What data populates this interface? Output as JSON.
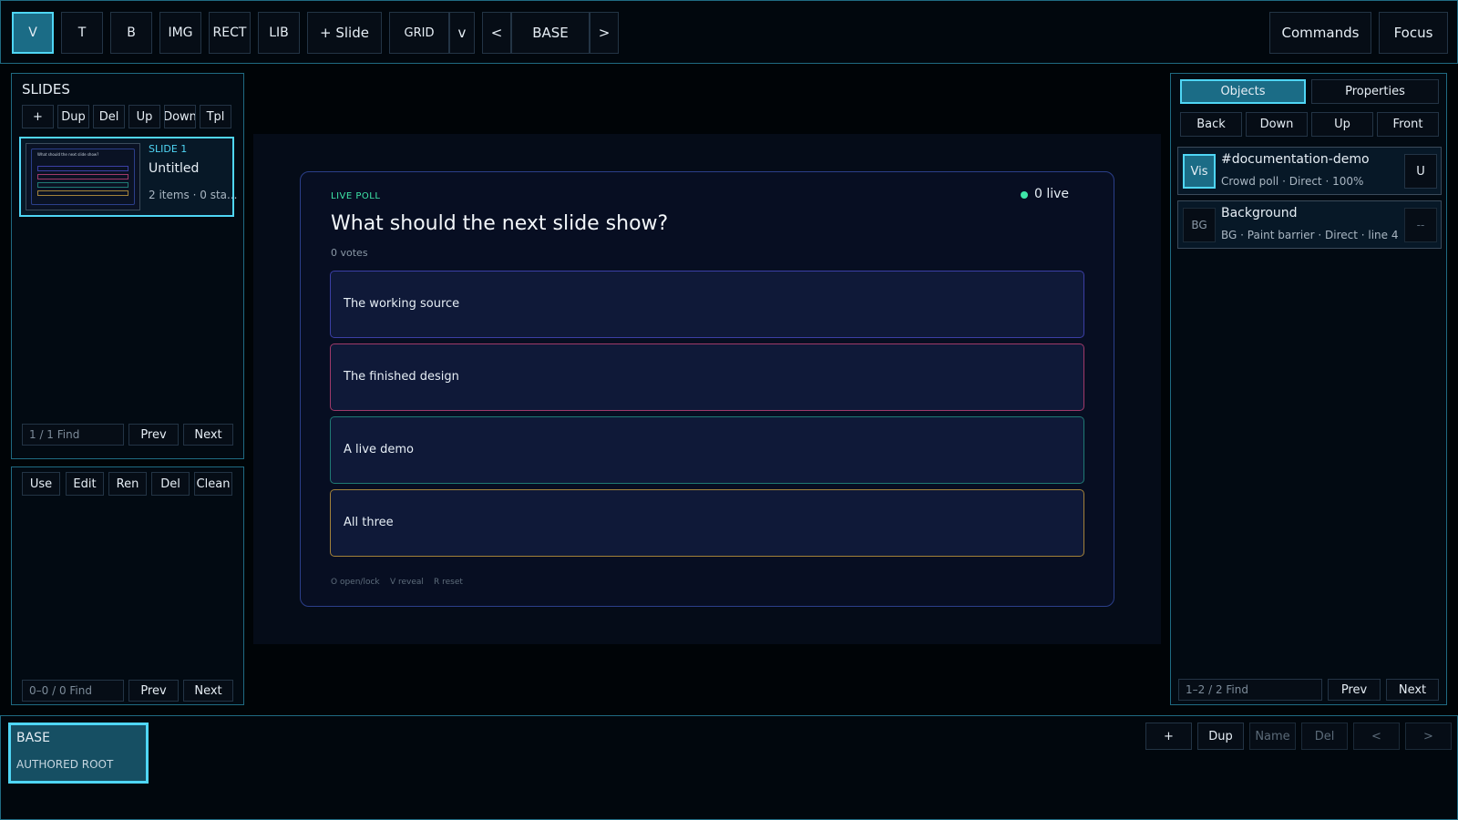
{
  "toolbar": {
    "tools": [
      "V",
      "T",
      "B",
      "IMG",
      "RECT",
      "LIB"
    ],
    "add_slide": "+ Slide",
    "grid": "GRID",
    "grid_toggle": "v",
    "prev": "<",
    "layer": "BASE",
    "next": ">",
    "commands": "Commands",
    "focus": "Focus"
  },
  "slides": {
    "title": "SLIDES",
    "actions": [
      "+",
      "Dup",
      "Del",
      "Up",
      "Down",
      "Tpl"
    ],
    "items": [
      {
        "number": "SLIDE 1",
        "name": "Untitled",
        "meta": "2 items · 0 sta..."
      }
    ],
    "thumb": {
      "title": "What should the next slide show?"
    },
    "find": "1 / 1  Find",
    "prev": "Prev",
    "next": "Next"
  },
  "library": {
    "actions": [
      "Use",
      "Edit",
      "Ren",
      "Del",
      "Clean"
    ],
    "find": "0–0 / 0  Find",
    "prev": "Prev",
    "next": "Next"
  },
  "poll": {
    "tag": "LIVE POLL",
    "live": "0 live",
    "question": "What should the next slide show?",
    "votes": "0 votes",
    "options": [
      {
        "label": "The working source",
        "color": "#3b3fa5"
      },
      {
        "label": "The finished design",
        "color": "#a03a6a"
      },
      {
        "label": "A live demo",
        "color": "#1f7a74"
      },
      {
        "label": "All three",
        "color": "#a3823a"
      }
    ],
    "hints": [
      "O  open/lock",
      "V  reveal",
      "R  reset"
    ]
  },
  "right": {
    "tabs": [
      "Objects",
      "Properties"
    ],
    "order": [
      "Back",
      "Down",
      "Up",
      "Front"
    ],
    "objects": [
      {
        "badge": "Vis",
        "name": "#documentation-demo",
        "meta": "Crowd poll · Direct · 100%",
        "action": "U"
      },
      {
        "badge": "BG",
        "name": "Background",
        "meta": "BG · Paint barrier · Direct · line 4",
        "action": "--"
      }
    ],
    "find": "1–2 / 2  Find",
    "prev": "Prev",
    "next": "Next"
  },
  "layers": {
    "current": {
      "name": "BASE",
      "sub": "AUTHORED ROOT"
    },
    "actions": [
      "+",
      "Dup",
      "Name",
      "Del",
      "<",
      ">"
    ]
  },
  "colors": {
    "accent": "#4fd6f5",
    "live_dot": "#3ee6a8",
    "poll_border": "#2b3f8a"
  }
}
